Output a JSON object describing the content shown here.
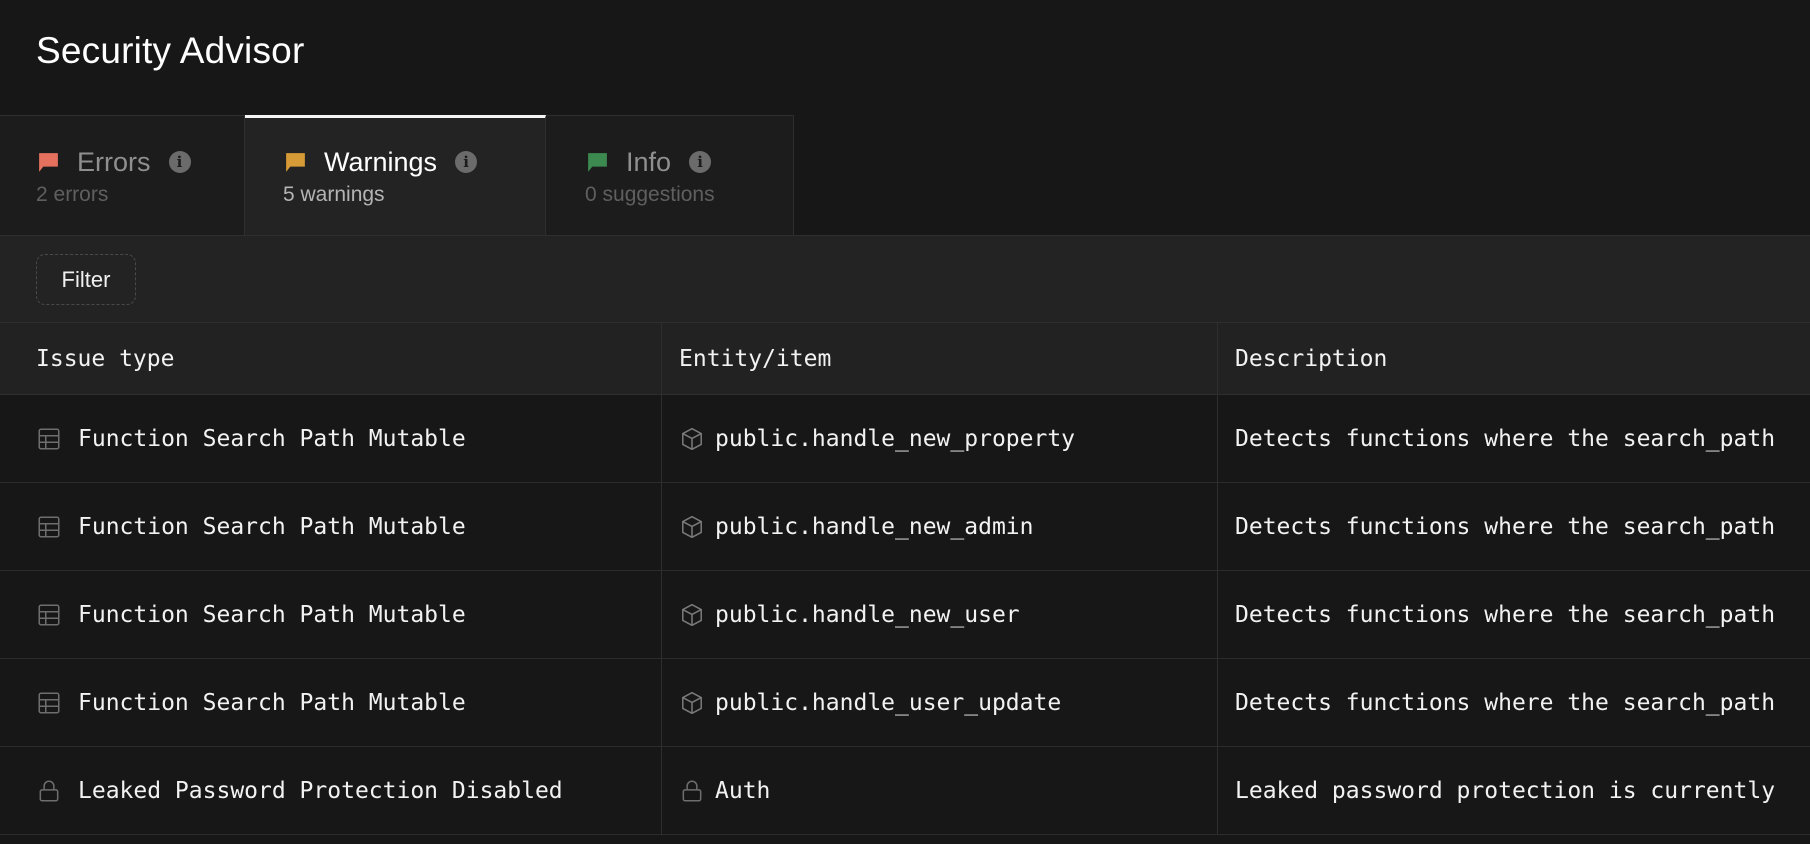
{
  "header": {
    "title": "Security Advisor"
  },
  "tabs": [
    {
      "label": "Errors",
      "sub": "2 errors",
      "flag_color": "#e5705e"
    },
    {
      "label": "Warnings",
      "sub": "5 warnings",
      "flag_color": "#d69a36",
      "active": true
    },
    {
      "label": "Info",
      "sub": "0 suggestions",
      "flag_color": "#3c8a4f"
    }
  ],
  "toolbar": {
    "filter_label": "Filter"
  },
  "table": {
    "columns": [
      "Issue type",
      "Entity/item",
      "Description"
    ],
    "rows": [
      {
        "issue_icon": "table-icon",
        "issue": "Function Search Path Mutable",
        "entity_icon": "cube-icon",
        "entity": "public.handle_new_property",
        "description": "Detects functions where the search_path"
      },
      {
        "issue_icon": "table-icon",
        "issue": "Function Search Path Mutable",
        "entity_icon": "cube-icon",
        "entity": "public.handle_new_admin",
        "description": "Detects functions where the search_path"
      },
      {
        "issue_icon": "table-icon",
        "issue": "Function Search Path Mutable",
        "entity_icon": "cube-icon",
        "entity": "public.handle_new_user",
        "description": "Detects functions where the search_path"
      },
      {
        "issue_icon": "table-icon",
        "issue": "Function Search Path Mutable",
        "entity_icon": "cube-icon",
        "entity": "public.handle_user_update",
        "description": "Detects functions where the search_path"
      },
      {
        "issue_icon": "lock-icon",
        "issue": "Leaked Password Protection Disabled",
        "entity_icon": "lock-icon",
        "entity": "Auth",
        "description": "Leaked password protection is currently"
      }
    ]
  }
}
